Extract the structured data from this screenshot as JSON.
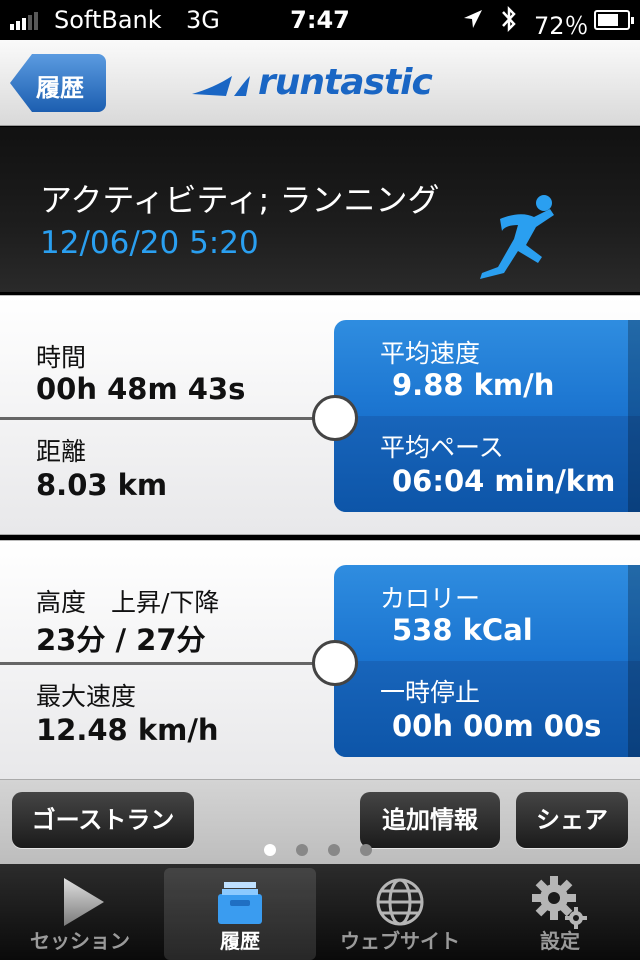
{
  "status_bar": {
    "carrier": "SoftBank",
    "network": "3G",
    "time": "7:47",
    "battery_text": "72％",
    "battery_level": 0.72
  },
  "nav": {
    "back_label": "履歴",
    "logo_text": "runtastic",
    "accent_color": "#1a66c4"
  },
  "activity": {
    "title": "アクティビティ; ランニング",
    "date": "12/06/20 5:20",
    "icon": "runner-icon"
  },
  "stats_primary": {
    "time_label": "時間",
    "time_value": "00h 48m 43s",
    "distance_label": "距離",
    "distance_value": "8.03 km",
    "avg_speed_label": "平均速度",
    "avg_speed_value": "9.88 km/h",
    "avg_pace_label": "平均ペース",
    "avg_pace_value": "06:04 min/km"
  },
  "stats_secondary": {
    "elevation_label": "高度　上昇/下降",
    "elevation_value": "23分 / 27分",
    "max_speed_label": "最大速度",
    "max_speed_value": "12.48 km/h",
    "calories_label": "カロリー",
    "calories_value": "538 kCal",
    "pause_label": "一時停止",
    "pause_value": "00h 00m 00s"
  },
  "actions": {
    "ghost_run": "ゴーストラン",
    "more_info": "追加情報",
    "share": "シェア",
    "page_count": 4,
    "current_page": 1
  },
  "tabs": [
    {
      "label": "セッション",
      "icon": "play-icon",
      "active": false
    },
    {
      "label": "履歴",
      "icon": "inbox-tray-icon",
      "active": true
    },
    {
      "label": "ウェブサイト",
      "icon": "globe-icon",
      "active": false
    },
    {
      "label": "設定",
      "icon": "gear-icon",
      "active": false
    }
  ]
}
